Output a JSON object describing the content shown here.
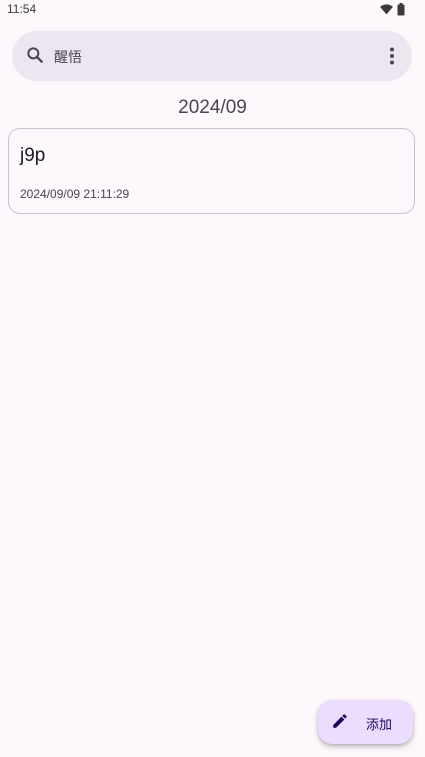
{
  "status_bar": {
    "time": "11:54",
    "icons": [
      "wifi-icon",
      "battery-icon"
    ]
  },
  "search": {
    "value": "醒悟",
    "icon": "search-icon",
    "menu_icon": "more-vert-icon"
  },
  "list": {
    "group_header": "2024/09",
    "notes": [
      {
        "title": "j9p",
        "timestamp": "2024/09/09 21:11:29"
      }
    ]
  },
  "fab": {
    "label": "添加",
    "icon": "edit-pencil-icon"
  },
  "colors": {
    "background": "#fef7fc",
    "search_bar": "#ece6f0",
    "card_border": "#cac4d0",
    "fab_background": "#eaddff",
    "fab_foreground": "#21005d"
  }
}
